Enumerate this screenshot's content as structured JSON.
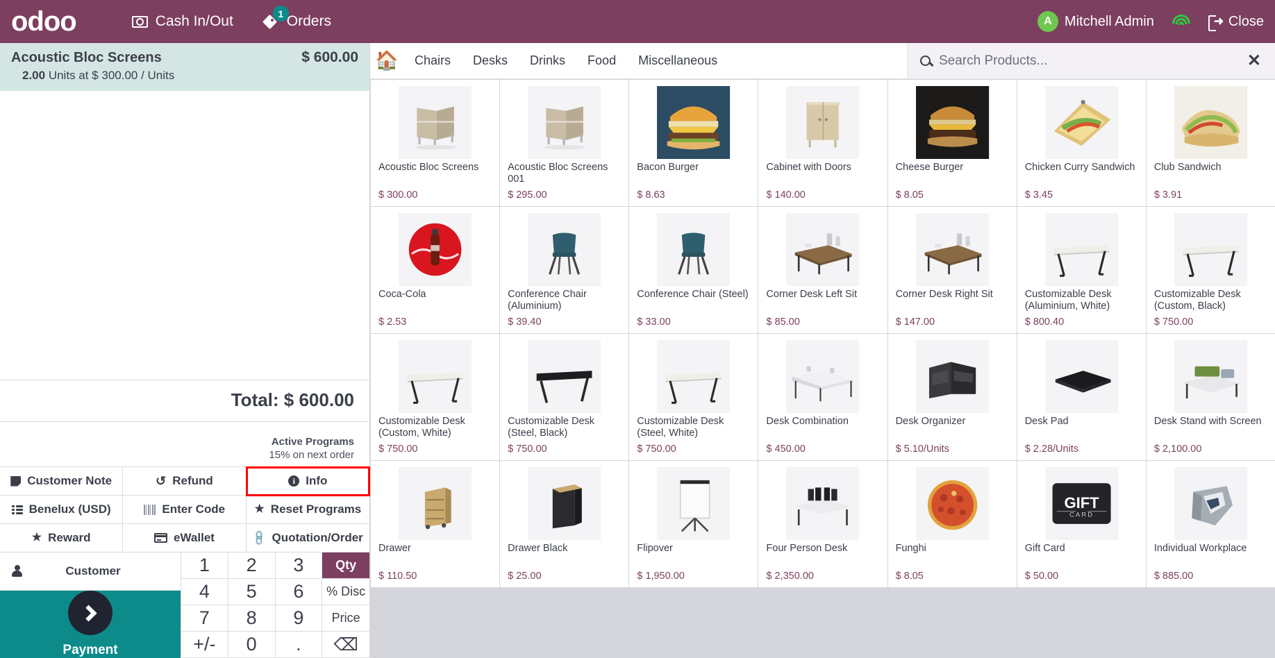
{
  "topbar": {
    "logo": "odoo",
    "cash_in_out": "Cash In/Out",
    "orders": "Orders",
    "orders_badge": "1",
    "user_initial": "A",
    "user_name": "Mitchell Admin",
    "close": "Close",
    "accent_color": "#7c3f5f",
    "wifi_color": "#2ecc40"
  },
  "order": {
    "line_name": "Acoustic Bloc Screens",
    "line_total": "$ 600.00",
    "line_qty": "2.00",
    "line_detail": "Units at $ 300.00 / Units",
    "total_label": "Total: $ 600.00",
    "programs_title": "Active Programs",
    "programs_line": "15% on next order"
  },
  "controls": [
    {
      "label": "Customer Note",
      "icon": "note-icon",
      "highlighted": false
    },
    {
      "label": "Refund",
      "icon": "refund-icon",
      "highlighted": false
    },
    {
      "label": "Info",
      "icon": "info-icon",
      "highlighted": true
    },
    {
      "label": "Benelux (USD)",
      "icon": "pricelist-icon",
      "highlighted": false
    },
    {
      "label": "Enter Code",
      "icon": "barcode-icon",
      "highlighted": false
    },
    {
      "label": "Reset Programs",
      "icon": "star-icon",
      "highlighted": false
    },
    {
      "label": "Reward",
      "icon": "star-icon",
      "highlighted": false
    },
    {
      "label": "eWallet",
      "icon": "card-icon",
      "highlighted": false
    },
    {
      "label": "Quotation/Order",
      "icon": "link-icon",
      "highlighted": false
    }
  ],
  "customer": {
    "label": "Customer"
  },
  "payment": {
    "label": "Payment"
  },
  "numpad": [
    {
      "key": "1",
      "type": "digit"
    },
    {
      "key": "2",
      "type": "digit"
    },
    {
      "key": "3",
      "type": "digit"
    },
    {
      "key": "Qty",
      "type": "mode",
      "active": true
    },
    {
      "key": "4",
      "type": "digit"
    },
    {
      "key": "5",
      "type": "digit"
    },
    {
      "key": "6",
      "type": "digit"
    },
    {
      "key": "% Disc",
      "type": "mode",
      "active": false
    },
    {
      "key": "7",
      "type": "digit"
    },
    {
      "key": "8",
      "type": "digit"
    },
    {
      "key": "9",
      "type": "digit"
    },
    {
      "key": "Price",
      "type": "mode",
      "active": false
    },
    {
      "key": "+/-",
      "type": "digit"
    },
    {
      "key": "0",
      "type": "digit"
    },
    {
      "key": ".",
      "type": "digit"
    },
    {
      "key": "⌫",
      "type": "backspace"
    }
  ],
  "product_header": {
    "home_icon": "home-icon",
    "categories": [
      "Chairs",
      "Desks",
      "Drinks",
      "Food",
      "Miscellaneous"
    ],
    "search_placeholder": "Search Products...",
    "search_value": ""
  },
  "products": [
    {
      "name": "Acoustic Bloc Screens",
      "price": "$ 300.00",
      "img": "screen"
    },
    {
      "name": "Acoustic Bloc Screens 001",
      "price": "$ 295.00",
      "img": "screen"
    },
    {
      "name": "Bacon Burger",
      "price": "$ 8.63",
      "img": "burger"
    },
    {
      "name": "Cabinet with Doors",
      "price": "$ 140.00",
      "img": "cabinet"
    },
    {
      "name": "Cheese Burger",
      "price": "$ 8.05",
      "img": "burger-dark"
    },
    {
      "name": "Chicken Curry Sandwich",
      "price": "$ 3.45",
      "img": "sandwich-board"
    },
    {
      "name": "Club Sandwich",
      "price": "$ 3.91",
      "img": "club-sandwich"
    },
    {
      "name": "Coca-Cola",
      "price": "$ 2.53",
      "img": "cola"
    },
    {
      "name": "Conference Chair (Aluminium)",
      "price": "$ 39.40",
      "img": "chair"
    },
    {
      "name": "Conference Chair (Steel)",
      "price": "$ 33.00",
      "img": "chair"
    },
    {
      "name": "Corner Desk Left Sit",
      "price": "$ 85.00",
      "img": "corner-desk"
    },
    {
      "name": "Corner Desk Right Sit",
      "price": "$ 147.00",
      "img": "corner-desk"
    },
    {
      "name": "Customizable Desk (Aluminium, White)",
      "price": "$ 800.40",
      "img": "desk"
    },
    {
      "name": "Customizable Desk (Custom, Black)",
      "price": "$ 750.00",
      "img": "desk"
    },
    {
      "name": "Customizable Desk (Custom, White)",
      "price": "$ 750.00",
      "img": "desk"
    },
    {
      "name": "Customizable Desk (Steel, Black)",
      "price": "$ 750.00",
      "img": "desk-black"
    },
    {
      "name": "Customizable Desk (Steel, White)",
      "price": "$ 750.00",
      "img": "desk"
    },
    {
      "name": "Desk Combination",
      "price": "$ 450.00",
      "img": "desk-combo"
    },
    {
      "name": "Desk Organizer",
      "price": "$ 5.10/Units",
      "img": "organizer"
    },
    {
      "name": "Desk Pad",
      "price": "$ 2.28/Units",
      "img": "pad"
    },
    {
      "name": "Desk Stand with Screen",
      "price": "$ 2,100.00",
      "img": "stand-screen"
    },
    {
      "name": "Drawer",
      "price": "$ 110.50",
      "img": "drawer"
    },
    {
      "name": "Drawer Black",
      "price": "$ 25.00",
      "img": "drawer-black"
    },
    {
      "name": "Flipover",
      "price": "$ 1,950.00",
      "img": "flipover"
    },
    {
      "name": "Four Person Desk",
      "price": "$ 2,350.00",
      "img": "four-desk"
    },
    {
      "name": "Funghi",
      "price": "$ 8.05",
      "img": "pizza"
    },
    {
      "name": "Gift Card",
      "price": "$ 50.00",
      "img": "gift"
    },
    {
      "name": "Individual Workplace",
      "price": "$ 885.00",
      "img": "workplace"
    }
  ]
}
